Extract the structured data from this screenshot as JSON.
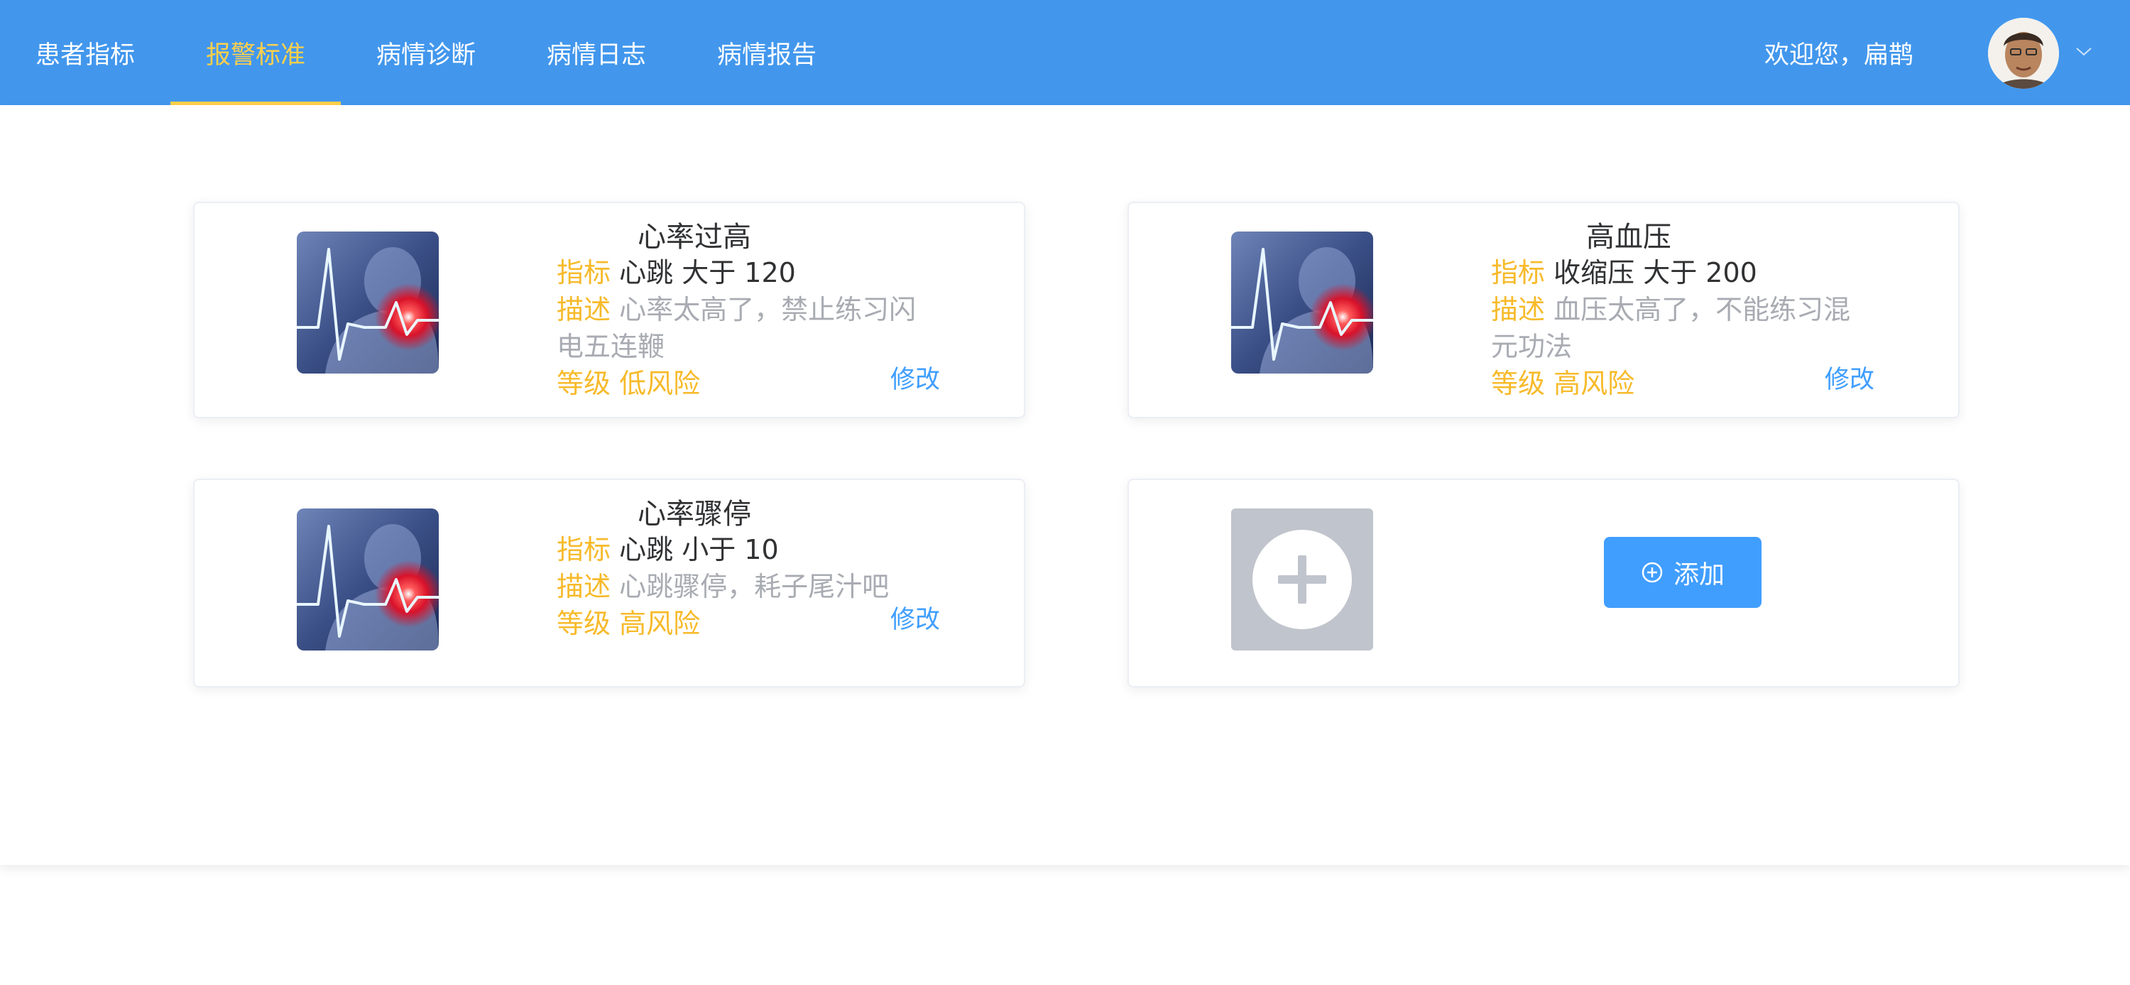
{
  "nav": {
    "items": [
      {
        "label": "患者指标"
      },
      {
        "label": "报警标准"
      },
      {
        "label": "病情诊断"
      },
      {
        "label": "病情日志"
      },
      {
        "label": "病情报告"
      }
    ],
    "active_index": 1,
    "welcome": "欢迎您，扁鹊"
  },
  "cards": [
    {
      "title": "心率过高",
      "indicator_label": "指标",
      "indicator_value": "心跳 大于 120",
      "desc_label": "描述",
      "desc_line1": "心率太高了，禁止练习闪",
      "desc_line2": "电五连鞭",
      "level_label": "等级",
      "level_value": "低风险",
      "edit_label": "修改"
    },
    {
      "title": "高血压",
      "indicator_label": "指标",
      "indicator_value": "收缩压 大于 200",
      "desc_label": "描述",
      "desc_line1": "血压太高了，不能练习混",
      "desc_line2": "元功法",
      "level_label": "等级",
      "level_value": "高风险",
      "edit_label": "修改"
    },
    {
      "title": "心率骤停",
      "indicator_label": "指标",
      "indicator_value": "心跳 小于 10",
      "desc_label": "描述",
      "desc_line1": "心跳骤停，耗子尾汁吧",
      "level_label": "等级",
      "level_value": "高风险",
      "edit_label": "修改"
    }
  ],
  "add_card": {
    "button_label": "添加"
  },
  "colors": {
    "header_bg": "#4297ed",
    "nav_active": "#ffd04b",
    "label": "#f7ba2a",
    "link": "#409eff",
    "description": "#a8abb2"
  },
  "icons": {
    "card_image": "heart-pulse-image",
    "add": "plus-icon",
    "add_button": "plus-circle-icon",
    "avatar_caret": "chevron-down-icon"
  }
}
